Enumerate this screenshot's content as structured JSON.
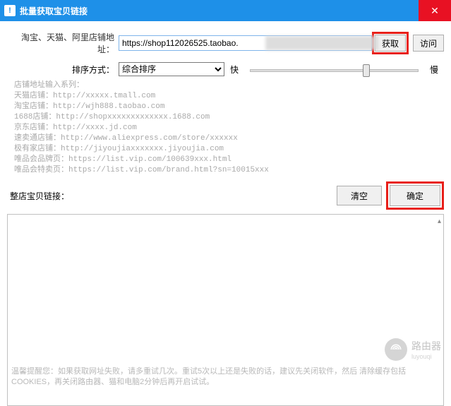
{
  "window": {
    "title": "批量获取宝贝链接",
    "close": "✕"
  },
  "url_row": {
    "label": "淘宝、天猫、阿里店铺地址：",
    "value": "https://shop112026525.taobao.",
    "fetch_btn": "获取",
    "visit_btn": "访问"
  },
  "sort_row": {
    "label": "排序方式：",
    "selected": "综合排序",
    "fast": "快",
    "slow": "慢",
    "slider_value": 70
  },
  "examples_text": "店铺地址输入系列：\n天猫店铺：http://xxxxx.tmall.com\n淘宝店铺：http://wjh888.taobao.com\n1688店铺：http://shopxxxxxxxxxxxxx.1688.com\n京东店铺：http://xxxx.jd.com\n速卖通店铺：http://www.aliexpress.com/store/xxxxxx\n极有家店铺：http://jiyoujiaxxxxxxx.jiyoujia.com\n唯品会品牌页：https://list.vip.com/100639xxx.html\n唯品会特卖页：https://list.vip.com/brand.html?sn=10015xxx",
  "actions": {
    "links_label": "整店宝贝链接：",
    "clear_btn": "清空",
    "confirm_btn": "确定"
  },
  "textarea": {
    "value": ""
  },
  "footer_tip": "温馨提醒您：如果获取网址失败，请多重试几次。重试5次以上还是失败的话，建议先关闭软件，然后\n清除缓存包括COOKIES，再关闭路由器、猫和电脑2分钟后再开启试试。",
  "watermark": {
    "main": "路由器",
    "sub": "luyouqi"
  }
}
